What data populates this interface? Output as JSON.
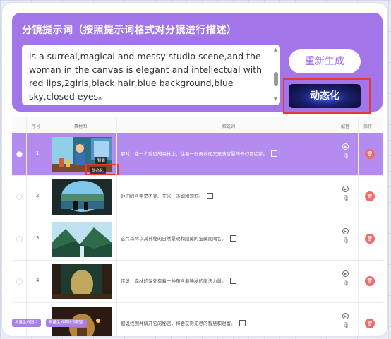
{
  "prompt": {
    "title": "分镜提示词（按照提示词格式对分镜进行描述）",
    "text": "is a surreal,magical and messy studio scene,and the woman in the canvas is elegant and intellectual with red lips,2girls,black hair,blue background,blue sky,closed eyes。",
    "regenerate_label": "重新生成",
    "dynamic_label": "动态化"
  },
  "table": {
    "headers": {
      "seq": "序号",
      "storyboard": "素材图",
      "description": "解说词",
      "voice": "配音",
      "action": "操作"
    },
    "rows": [
      {
        "seq": "1",
        "desc": "那时，在一个遥远的森林上，住着一群勇敢而又充满智慧的奇幻冒险家。",
        "selected": true,
        "badge_top": "智能",
        "badge_bottom": "动态化"
      },
      {
        "seq": "2",
        "desc": "他们的名字是杰克、艾米、汤姆和莉莉。",
        "selected": false
      },
      {
        "seq": "3",
        "desc": "这片森林以其神秘的自然景观和隐藏的宝藏而闻名。",
        "selected": false
      },
      {
        "seq": "4",
        "desc": "传说，森林的深处有着一种蕴含着神秘的魔法力量。",
        "selected": false
      },
      {
        "seq": "5",
        "desc": "据说找到并解开它的秘密，将会获得无尽的智慧和财富。",
        "selected": false
      }
    ]
  },
  "footer": {
    "button1": "批量生成图片",
    "button2": "批量生成解说词配音"
  },
  "colors": {
    "accent": "#a275e8",
    "selected_row": "#b48bef",
    "danger": "#f06a6a",
    "highlight": "#e53935"
  }
}
